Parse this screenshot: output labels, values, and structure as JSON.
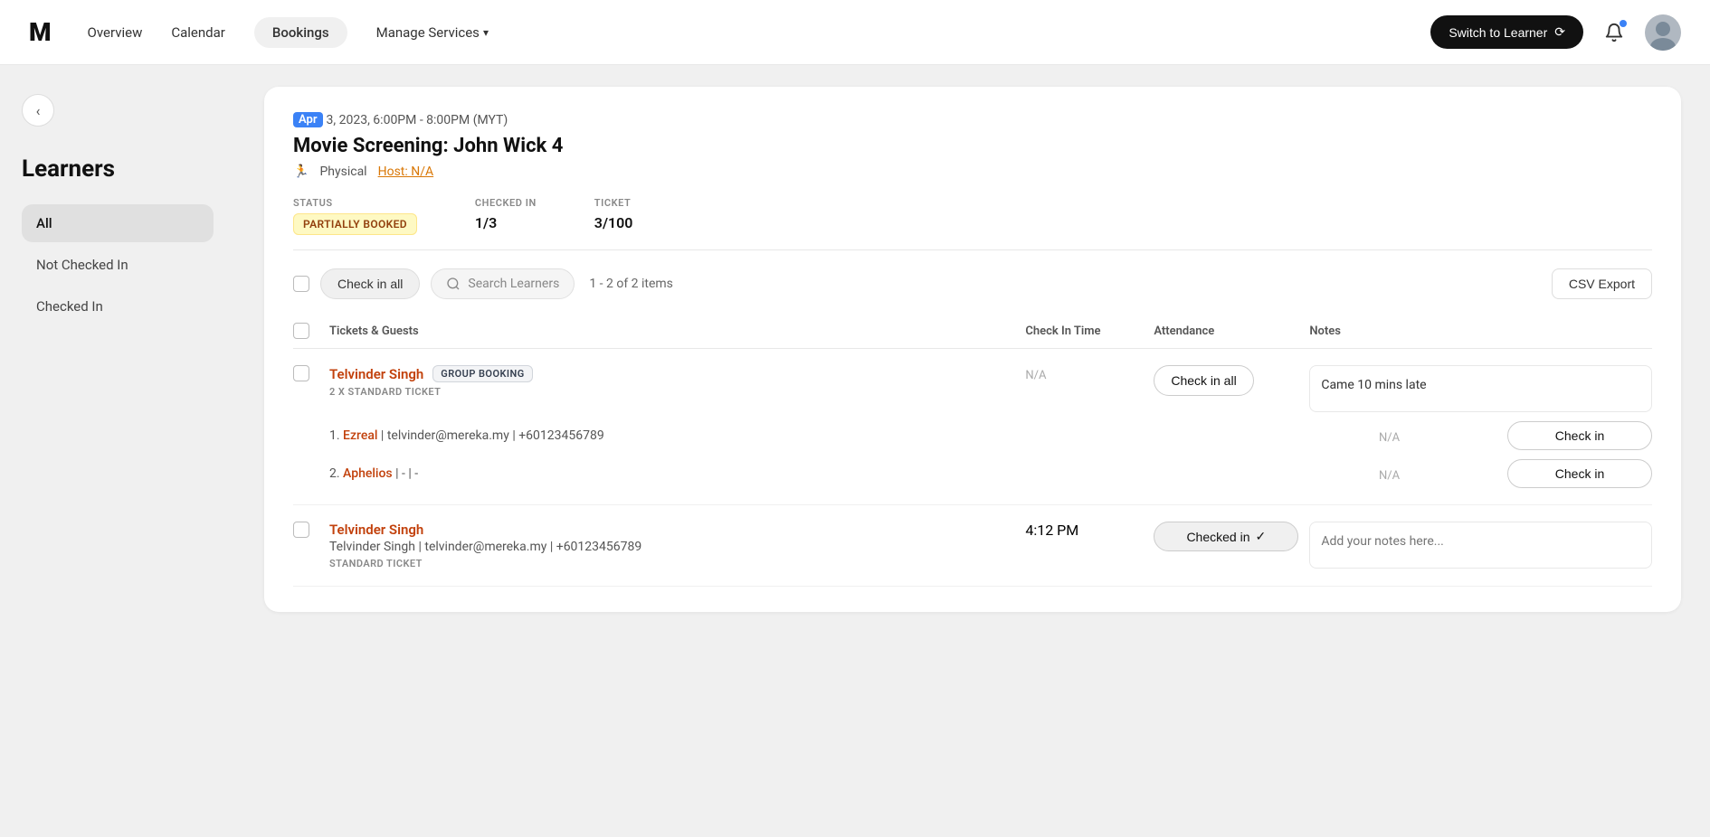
{
  "nav": {
    "logo": "M",
    "links": [
      "Overview",
      "Calendar",
      "Bookings",
      "Manage Services"
    ],
    "active_link": "Bookings",
    "manage_has_dropdown": true,
    "switch_learner_label": "Switch to Learner"
  },
  "sidebar": {
    "title": "Learners",
    "back_label": "‹",
    "items": [
      {
        "label": "All",
        "active": true
      },
      {
        "label": "Not Checked In",
        "active": false
      },
      {
        "label": "Checked In",
        "active": false
      }
    ]
  },
  "event": {
    "date_highlight": "Apr",
    "date_rest": "3, 2023, 6:00PM - 8:00PM (MYT)",
    "title": "Movie Screening: John Wick 4",
    "type": "Physical",
    "host_label": "Host: N/A",
    "status_label": "STATUS",
    "status_value": "PARTIALLY BOOKED",
    "checked_in_label": "CHECKED IN",
    "checked_in_value": "1/3",
    "ticket_label": "TICKET",
    "ticket_value": "3/100"
  },
  "toolbar": {
    "check_in_all_label": "Check in all",
    "search_placeholder": "Search Learners",
    "items_count": "1 - 2 of 2 items",
    "csv_export_label": "CSV Export"
  },
  "table": {
    "headers": {
      "tickets_guests": "Tickets & Guests",
      "check_in_time": "Check In Time",
      "attendance": "Attendance",
      "notes": "Notes"
    },
    "rows": [
      {
        "id": "row1",
        "name": "Telvinder Singh",
        "badge": "GROUP BOOKING",
        "ticket_type": "2 X STANDARD TICKET",
        "check_in_time": "",
        "attendance_label": "Check in all",
        "notes_value": "Came 10 mins late",
        "is_group": true,
        "guests": [
          {
            "number": "1.",
            "name": "Ezreal",
            "email": "telvinder@mereka.my",
            "phone": "+60123456789",
            "check_in_time": "N/A",
            "attendance_label": "Check in",
            "checked_in": false
          },
          {
            "number": "2.",
            "name": "Aphelios",
            "email": "-",
            "phone": "-",
            "check_in_time": "N/A",
            "attendance_label": "Check in",
            "checked_in": false
          }
        ]
      },
      {
        "id": "row2",
        "name": "Telvinder Singh",
        "badge": "",
        "ticket_type": "STANDARD TICKET",
        "sub_name": "Telvinder Singh",
        "email": "telvinder@mereka.my",
        "phone": "+60123456789",
        "check_in_time": "4:12 PM",
        "attendance_label": "Checked in",
        "checked_in": true,
        "notes_placeholder": "Add your notes here...",
        "is_group": false
      }
    ]
  }
}
